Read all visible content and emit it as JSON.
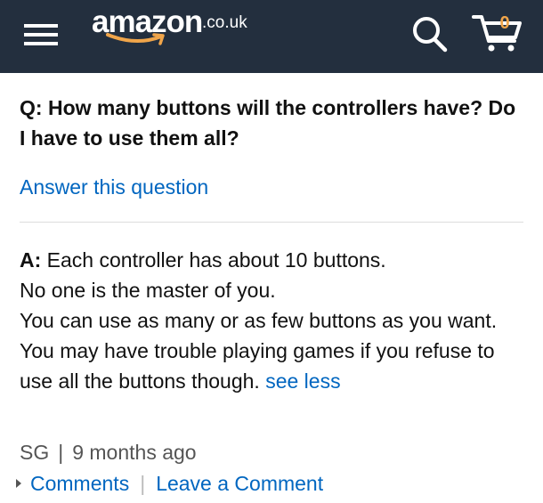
{
  "header": {
    "logo_word": "amazon",
    "logo_tld": ".co.uk",
    "cart_count": "0",
    "colors": {
      "bar": "#232f3e",
      "accent": "#f0a54a",
      "link": "#0066c0"
    },
    "icons": [
      "menu-icon",
      "amazon-smile-icon",
      "search-icon",
      "cart-icon"
    ]
  },
  "question": {
    "prefix": "Q:",
    "text": "How many buttons will the controllers have? Do I have to use them all?",
    "answer_link": "Answer this question"
  },
  "answer": {
    "prefix": "A:",
    "line1": "Each controller has about 10 buttons.",
    "line2": "No one is the master of you.",
    "line3": "You can use as many or as few buttons as you want. You may have trouble playing games if you refuse to use all the buttons though.",
    "see_less": "see less"
  },
  "meta": {
    "author": "SG",
    "separator": "|",
    "time": "9 months ago"
  },
  "actions": {
    "comments": "Comments",
    "separator": "|",
    "leave_comment": "Leave a Comment"
  }
}
